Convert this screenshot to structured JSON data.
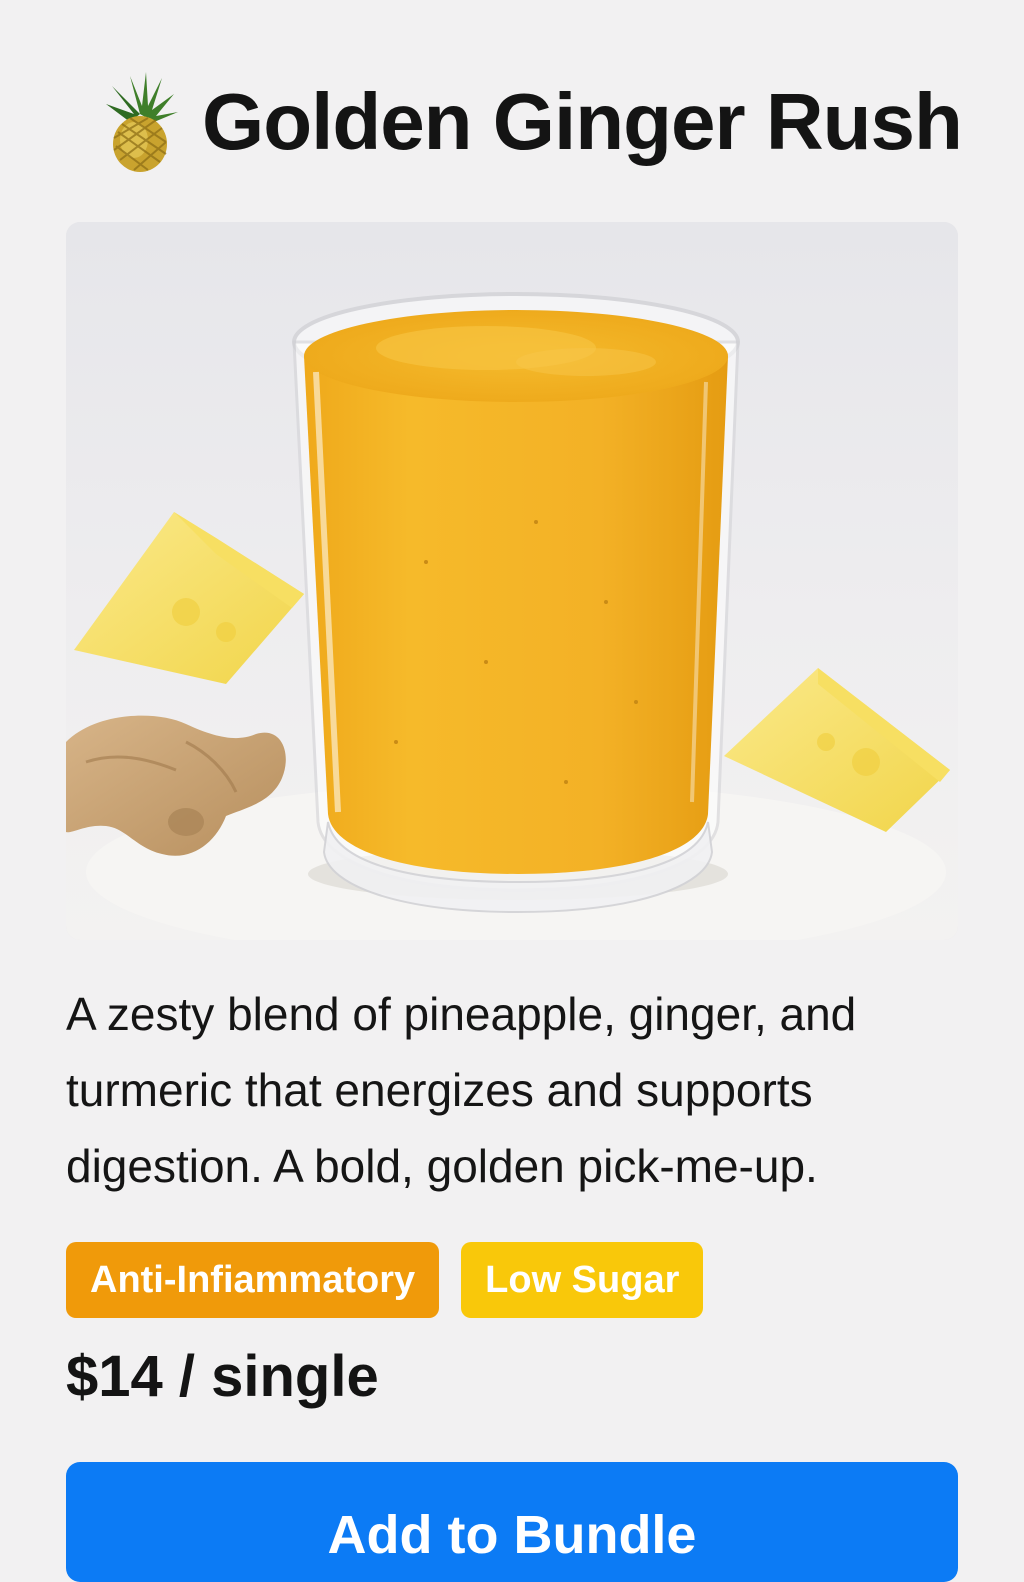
{
  "header": {
    "icon": "pineapple-icon",
    "title": "Golden Ginger Rush"
  },
  "product": {
    "image_subject": "smoothie-photo",
    "description": "A zesty blend of pineapple, ginger, and turmeric that energizes and supports digestion. A bold, golden pick-me-up.",
    "tags": [
      {
        "label": "Anti-Infiammatory",
        "color": "#f09a0a"
      },
      {
        "label": "Low Sugar",
        "color": "#f9c80a"
      }
    ],
    "price": "$14 / single"
  },
  "actions": {
    "add_label": "Add to Bundle",
    "accent": "#0c7bf5"
  }
}
